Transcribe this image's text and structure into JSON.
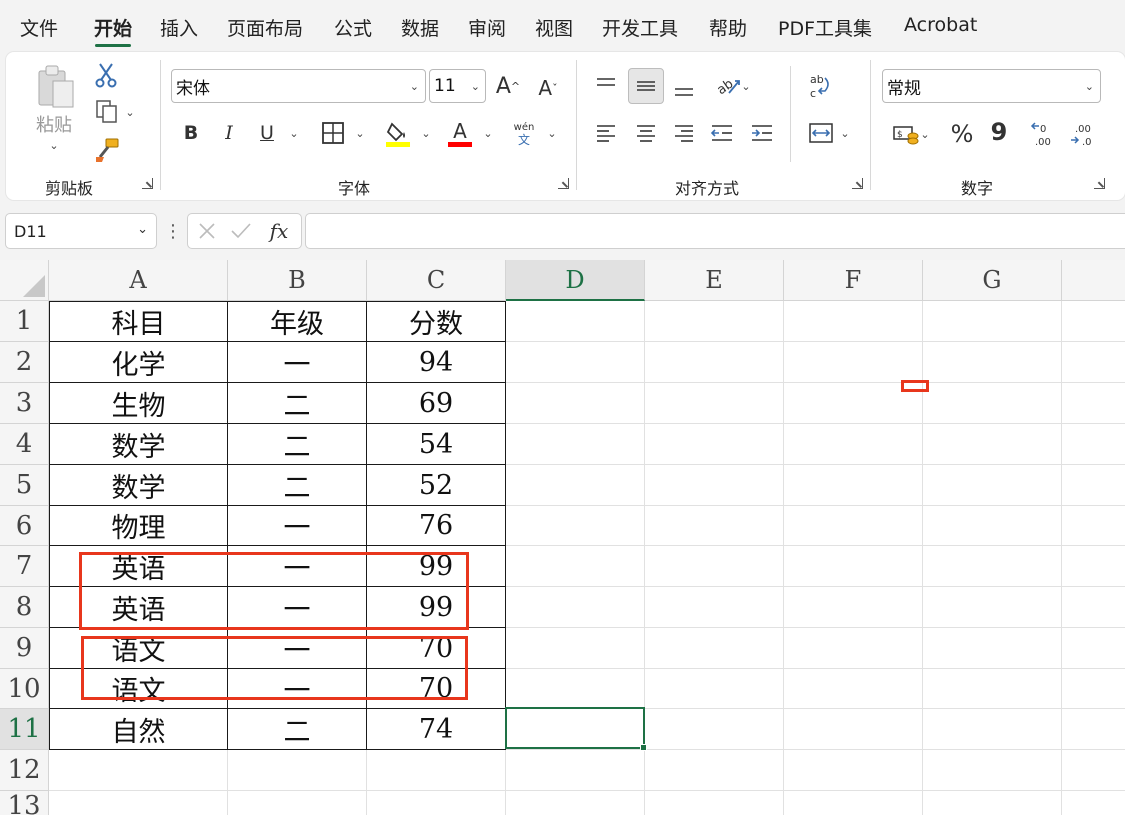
{
  "menu": {
    "items": [
      "文件",
      "开始",
      "插入",
      "页面布局",
      "公式",
      "数据",
      "审阅",
      "视图",
      "开发工具",
      "帮助",
      "PDF工具集",
      "Acrobat"
    ],
    "active": "开始"
  },
  "ribbon": {
    "clipboard": {
      "paste_label": "粘贴",
      "group_label": "剪贴板"
    },
    "font": {
      "font_name": "宋体",
      "font_size": "11",
      "bold": "B",
      "italic": "I",
      "underline": "U",
      "font_color_glyph": "A",
      "phonetic_top": "wén",
      "phonetic_bottom": "文",
      "group_label": "字体",
      "fill_color": "#ffff00",
      "font_color": "#ff0000"
    },
    "alignment": {
      "group_label": "对齐方式"
    },
    "number": {
      "format": "常规",
      "percent": "%",
      "comma": "9",
      "group_label": "数字"
    }
  },
  "formula_bar": {
    "name_box": "D11",
    "fx": "fx",
    "formula": ""
  },
  "sheet": {
    "columns": [
      "A",
      "B",
      "C",
      "D",
      "E",
      "F",
      "G"
    ],
    "selected_column": "D",
    "selected_row": "11",
    "rows": [
      {
        "num": "1",
        "cells": [
          "科目",
          "年级",
          "分数"
        ]
      },
      {
        "num": "2",
        "cells": [
          "化学",
          "一",
          "94"
        ]
      },
      {
        "num": "3",
        "cells": [
          "生物",
          "二",
          "69"
        ]
      },
      {
        "num": "4",
        "cells": [
          "数学",
          "二",
          "54"
        ]
      },
      {
        "num": "5",
        "cells": [
          "数学",
          "二",
          "52"
        ]
      },
      {
        "num": "6",
        "cells": [
          "物理",
          "一",
          "76"
        ]
      },
      {
        "num": "7",
        "cells": [
          "英语",
          "一",
          "99"
        ]
      },
      {
        "num": "8",
        "cells": [
          "英语",
          "一",
          "99"
        ]
      },
      {
        "num": "9",
        "cells": [
          "语文",
          "一",
          "70"
        ]
      },
      {
        "num": "10",
        "cells": [
          "语文",
          "一",
          "70"
        ]
      },
      {
        "num": "11",
        "cells": [
          "自然",
          "二",
          "74"
        ]
      },
      {
        "num": "12",
        "cells": [
          "",
          "",
          ""
        ]
      },
      {
        "num": "13",
        "cells": [
          "",
          "",
          ""
        ]
      }
    ]
  },
  "colors": {
    "accent": "#1e7145",
    "annotation": "#e8361c"
  }
}
